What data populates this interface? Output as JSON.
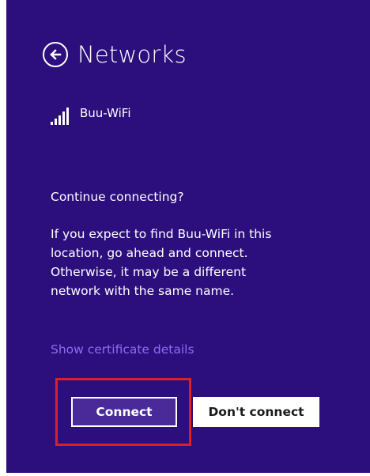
{
  "header": {
    "title": "Networks",
    "back_icon": "back-arrow-icon"
  },
  "network": {
    "name": "Buu-WiFi",
    "signal_icon": "wifi-signal-icon"
  },
  "prompt": {
    "question": "Continue connecting?",
    "message_lines": [
      "If you expect to find Buu-WiFi in this",
      "location, go ahead and connect.",
      "Otherwise, it may be a different",
      "network with the same name."
    ],
    "certificate_link": "Show certificate details"
  },
  "buttons": {
    "connect_label": "Connect",
    "dont_connect_label": "Don't connect"
  },
  "colors": {
    "background": "#2c0f7d",
    "link": "#8f6bf0",
    "highlight": "#e02020"
  }
}
